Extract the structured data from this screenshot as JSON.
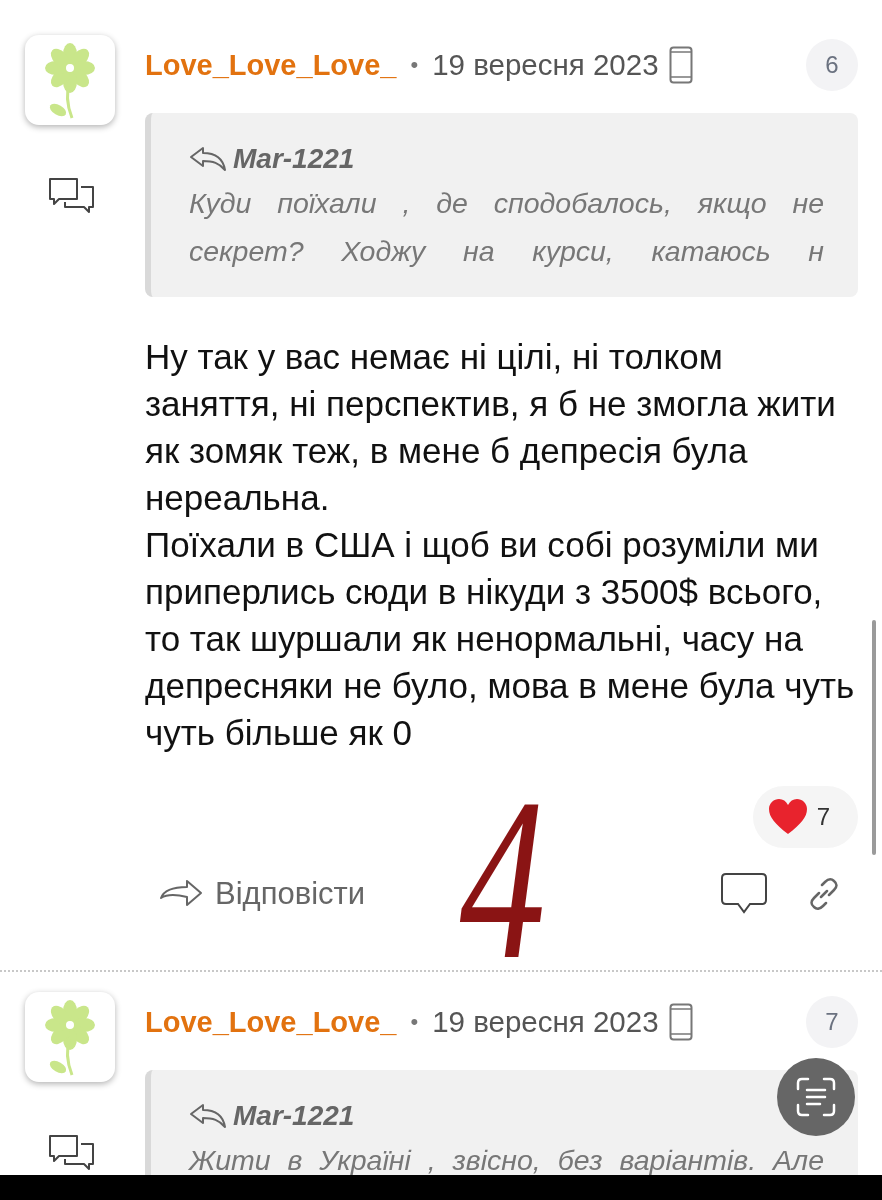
{
  "posts": [
    {
      "author": "Love_Love_Love_",
      "separator": "•",
      "date": "19 вересня 2023",
      "number": "6",
      "quote": {
        "author": "Mar-1221",
        "text": "Куди поїхали , де сподобалось, якщо не секрет? Ходжу на курси, катаюсь н"
      },
      "body": [
        "Ну так у вас немає ні цілі, ні толком заняття, ні перспектив, я б не змогла жити як зомяк теж, в мене б депресія була нереальна.",
        "Поїхали в США і щоб ви собі розуміли ми приперлись сюди в нікуди з 3500$ всього, то так шуршали як ненормальні, часу на депресняки не було, мова в мене була чуть чуть більше як 0"
      ],
      "likes": "7",
      "reply_label": "Відповісти",
      "annotation": "4"
    },
    {
      "author": "Love_Love_Love_",
      "separator": "•",
      "date": "19 вересня 2023",
      "number": "7",
      "quote": {
        "author": "Mar-1221",
        "text": "Жити в Україні , звісно, без варіантів. Але"
      }
    }
  ]
}
